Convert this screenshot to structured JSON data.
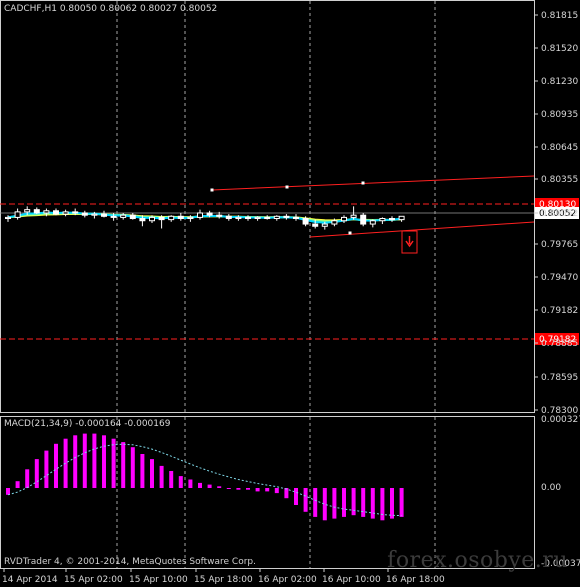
{
  "window": {
    "symbol_line": "CADCHF,H1  0.80050 0.80062 0.80027 0.80052",
    "copyright": "RVDTrader 4, © 2001-2014, MetaQuotes Software Corp.",
    "watermark": "forex.osobye.ru"
  },
  "colors": {
    "background": "#000000",
    "grid": "#cfcfcf",
    "candle_bull": "#ffffff",
    "candle_bear": "#ffffff",
    "ma_fast": "#00d8ff",
    "ma_slow": "#ffff40",
    "ma_mid": "#90ff90",
    "channel": "#ff2020",
    "macd_hist": "#ff00ff",
    "macd_signal": "#7fd8e8",
    "price_tag": "#ff0000"
  },
  "price_axis": {
    "labels": [
      "0.81815",
      "0.81520",
      "0.81230",
      "0.80935",
      "0.80645",
      "0.80355",
      "0.80052",
      "0.79765",
      "0.79470",
      "0.79182",
      "0.78885",
      "0.78595",
      "0.78300"
    ],
    "current_price": "0.80052",
    "tag_upper": "0.80130",
    "tag_lower": "0.79182"
  },
  "macd": {
    "label": "MACD(21,34,9) -0.000164 -0.000169",
    "axis_top": "0.000327",
    "axis_zero": "0.00",
    "axis_bottom": "-0.000379"
  },
  "time_axis": {
    "labels": [
      "14 Apr 2014",
      "15 Apr 02:00",
      "15 Apr 10:00",
      "15 Apr 18:00",
      "16 Apr 02:00",
      "16 Apr 10:00",
      "16 Apr 18:00"
    ]
  },
  "chart_data": {
    "type": "candlestick",
    "symbol": "CADCHF",
    "timeframe": "H1",
    "ylim": [
      0.783,
      0.8195
    ],
    "candles": [
      [
        0.8003,
        0.8006,
        0.8,
        0.8004
      ],
      [
        0.8004,
        0.8012,
        0.8002,
        0.8009
      ],
      [
        0.8009,
        0.8014,
        0.8006,
        0.8011
      ],
      [
        0.8011,
        0.8013,
        0.8007,
        0.8008
      ],
      [
        0.8008,
        0.8012,
        0.8005,
        0.801
      ],
      [
        0.801,
        0.8012,
        0.8006,
        0.8007
      ],
      [
        0.8007,
        0.8011,
        0.8005,
        0.8009
      ],
      [
        0.8009,
        0.8012,
        0.8006,
        0.8008
      ],
      [
        0.8008,
        0.801,
        0.8004,
        0.8006
      ],
      [
        0.8006,
        0.8009,
        0.8003,
        0.8007
      ],
      [
        0.8007,
        0.801,
        0.8004,
        0.8005
      ],
      [
        0.8005,
        0.8008,
        0.8001,
        0.8004
      ],
      [
        0.8004,
        0.8008,
        0.8002,
        0.8006
      ],
      [
        0.8006,
        0.8008,
        0.8002,
        0.8003
      ],
      [
        0.8003,
        0.8006,
        0.7996,
        0.8001
      ],
      [
        0.8001,
        0.8006,
        0.7999,
        0.8004
      ],
      [
        0.8004,
        0.8006,
        0.7994,
        0.8002
      ],
      [
        0.8002,
        0.8006,
        0.8,
        0.8005
      ],
      [
        0.8005,
        0.8008,
        0.8001,
        0.8003
      ],
      [
        0.8003,
        0.8006,
        0.8,
        0.8004
      ],
      [
        0.8004,
        0.8011,
        0.8002,
        0.8008
      ],
      [
        0.8008,
        0.801,
        0.8004,
        0.8006
      ],
      [
        0.8006,
        0.8009,
        0.8003,
        0.8005
      ],
      [
        0.8005,
        0.8007,
        0.8001,
        0.8003
      ],
      [
        0.8003,
        0.8006,
        0.8001,
        0.8004
      ],
      [
        0.8004,
        0.8006,
        0.8001,
        0.8003
      ],
      [
        0.8003,
        0.8005,
        0.8001,
        0.8004
      ],
      [
        0.8004,
        0.8006,
        0.8002,
        0.8003
      ],
      [
        0.8003,
        0.8006,
        0.8001,
        0.8005
      ],
      [
        0.8005,
        0.8007,
        0.8002,
        0.8004
      ],
      [
        0.8004,
        0.8007,
        0.8001,
        0.8003
      ],
      [
        0.8003,
        0.8005,
        0.7996,
        0.7998
      ],
      [
        0.7998,
        0.8002,
        0.7994,
        0.7996
      ],
      [
        0.7996,
        0.8,
        0.7993,
        0.7998
      ],
      [
        0.7998,
        0.8003,
        0.7996,
        0.8001
      ],
      [
        0.8001,
        0.8006,
        0.7999,
        0.8004
      ],
      [
        0.8004,
        0.8014,
        0.8002,
        0.8006
      ],
      [
        0.8006,
        0.8008,
        0.7996,
        0.7998
      ],
      [
        0.7998,
        0.8002,
        0.7995,
        0.8001
      ],
      [
        0.8001,
        0.8004,
        0.7998,
        0.8003
      ],
      [
        0.8003,
        0.8005,
        0.8,
        0.8002
      ],
      [
        0.8002,
        0.8005,
        0.8,
        0.8005
      ]
    ],
    "macd_histogram": [
      -4e-05,
      4e-05,
      0.00011,
      0.00017,
      0.00022,
      0.00026,
      0.00029,
      0.00031,
      0.00032,
      0.00032,
      0.00031,
      0.00029,
      0.00027,
      0.00024,
      0.0002,
      0.00017,
      0.00013,
      0.0001,
      7e-05,
      5e-05,
      3e-05,
      2e-05,
      1e-05,
      0.0,
      -1e-05,
      -1e-05,
      -2e-05,
      -2e-05,
      -3e-05,
      -6e-05,
      -0.0001,
      -0.00014,
      -0.00017,
      -0.00019,
      -0.00018,
      -0.00017,
      -0.00016,
      -0.00017,
      -0.00018,
      -0.00019,
      -0.00018,
      -0.00017
    ]
  }
}
